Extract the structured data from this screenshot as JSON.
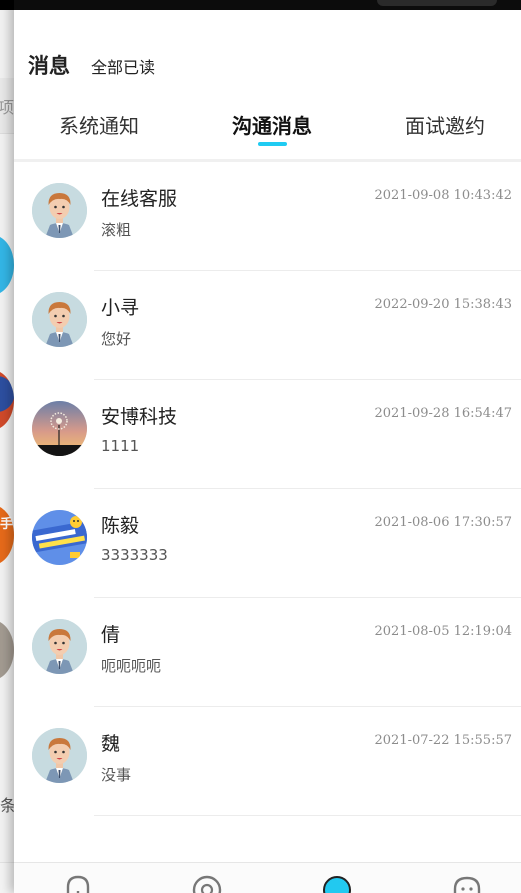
{
  "header": {
    "title": "消息",
    "mark_all_read": "全部已读"
  },
  "tabs": [
    {
      "label": "系统通知",
      "active": false
    },
    {
      "label": "沟通消息",
      "active": true
    },
    {
      "label": "面试邀约",
      "active": false
    }
  ],
  "colors": {
    "accent": "#1fcbf2",
    "text": "#222222",
    "muted": "#8c8c8c"
  },
  "messages": [
    {
      "name": "在线客服",
      "time": "2021-09-08 10:43:42",
      "preview": "滚粗",
      "avatar": "cartoon-man-avatar"
    },
    {
      "name": "小寻",
      "time": "2022-09-20 15:38:43",
      "preview": "您好",
      "avatar": "cartoon-man-avatar"
    },
    {
      "name": "安博科技",
      "time": "2021-09-28 16:54:47",
      "preview": "1111",
      "avatar": "dandelion-sunset-avatar"
    },
    {
      "name": "陈毅",
      "time": "2021-08-06 17:30:57",
      "preview": "3333333",
      "avatar": "game-banner-avatar"
    },
    {
      "name": "倩",
      "time": "2021-08-05 12:19:04",
      "preview": "呃呃呃呃",
      "avatar": "cartoon-man-avatar"
    },
    {
      "name": "魏",
      "time": "2021-07-22 15:55:57",
      "preview": "没事",
      "avatar": "cartoon-man-avatar"
    }
  ],
  "under_page": {
    "search_hint": "项",
    "bottom_text": "条",
    "badge_text": "手"
  },
  "bottom_nav": [
    {
      "icon": "home-icon"
    },
    {
      "icon": "discover-icon"
    },
    {
      "icon": "message-icon",
      "active": true
    },
    {
      "icon": "profile-icon"
    }
  ]
}
